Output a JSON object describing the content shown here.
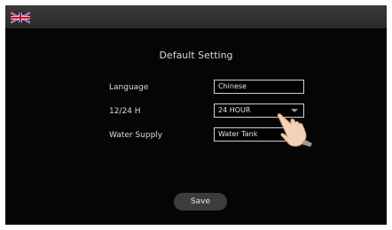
{
  "header": {
    "flag_icon": "uk-flag-icon"
  },
  "page": {
    "title": "Default Setting"
  },
  "settings": {
    "language": {
      "label": "Language",
      "value": "Chinese"
    },
    "time_format": {
      "label": "12/24 H",
      "value": "24 HOUR"
    },
    "water_supply": {
      "label": "Water Supply",
      "value": "Water Tank"
    }
  },
  "actions": {
    "save_label": "Save"
  },
  "overlay": {
    "hand_icon": "pointing-hand-icon"
  }
}
